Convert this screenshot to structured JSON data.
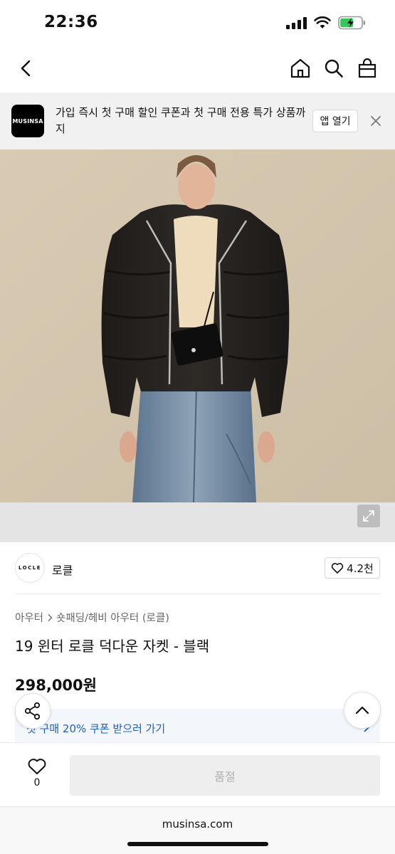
{
  "status_bar": {
    "time": "22:36"
  },
  "banner": {
    "logo_text": "MUSINSA",
    "message": "가입 즉시 첫 구매 할인 쿠폰과 첫 구매 전용 특가 상품까지",
    "open_button": "앱 열기"
  },
  "brand": {
    "logo_text": "LOCLE",
    "name": "로클",
    "likes": "4.2천"
  },
  "product": {
    "breadcrumb": [
      "아우터",
      "숏패딩/헤비 아우터 (로클)"
    ],
    "title": "19 윈터 로클 덕다운 자켓 - 블랙",
    "price": "298,000원",
    "coupon_text": "첫 구매 20% 쿠폰 받으러 가기"
  },
  "bottom_bar": {
    "wish_count": "0",
    "buy_button": "품절"
  },
  "browser": {
    "url": "musinsa.com"
  },
  "icons": {
    "back": "chevron-left-icon",
    "home": "home-icon",
    "search": "search-icon",
    "cart": "shopping-bag-icon",
    "close": "close-icon",
    "expand": "expand-icon",
    "heart": "heart-icon",
    "share": "share-icon",
    "scroll_top": "chevron-up-icon"
  },
  "colors": {
    "coupon_text": "#1f5fc9",
    "banner_bg": "#f1f1f1",
    "soldout_bg": "#eeeeee",
    "soldout_text": "#b1b1b1"
  }
}
